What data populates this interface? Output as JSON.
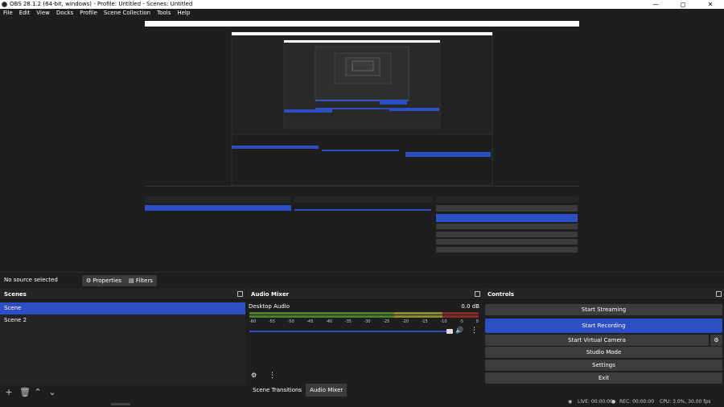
{
  "window": {
    "title": "OBS 28.1.2 (64-bit, windows) - Profile: Untitled - Scenes: Untitled",
    "controls": [
      "—",
      "◻",
      "✕"
    ]
  },
  "menu": [
    "File",
    "Edit",
    "View",
    "Docks",
    "Profile",
    "Scene Collection",
    "Tools",
    "Help"
  ],
  "sourcebar": {
    "no_source": "No source selected",
    "properties": "Properties",
    "filters": "Filters"
  },
  "scenes": {
    "title": "Scenes",
    "items": [
      "Scene",
      "Scene 2"
    ],
    "selected_index": 0
  },
  "audio_mixer": {
    "title": "Audio Mixer",
    "channel": "Desktop Audio",
    "level": "0.0 dB",
    "ticks": [
      "-60",
      "-55",
      "-50",
      "-45",
      "-40",
      "-35",
      "-30",
      "-25",
      "-20",
      "-15",
      "-10",
      "-5",
      "0"
    ],
    "tabs": [
      "Scene Transitions",
      "Audio Mixer"
    ],
    "active_tab": "Audio Mixer"
  },
  "controls": {
    "title": "Controls",
    "start_streaming": "Start Streaming",
    "start_recording": "Start Recording",
    "start_virtual_camera": "Start Virtual Camera",
    "studio_mode": "Studio Mode",
    "settings": "Settings",
    "exit": "Exit"
  },
  "status": {
    "live": "LIVE: 00:00:00",
    "rec": "REC: 00:00:00",
    "cpu": "CPU: 3.0%, 30.00 fps"
  },
  "colors": {
    "accent": "#2c4fc6",
    "background": "#1f1e1f",
    "panel": "#262526",
    "button": "#3c3c3c"
  }
}
